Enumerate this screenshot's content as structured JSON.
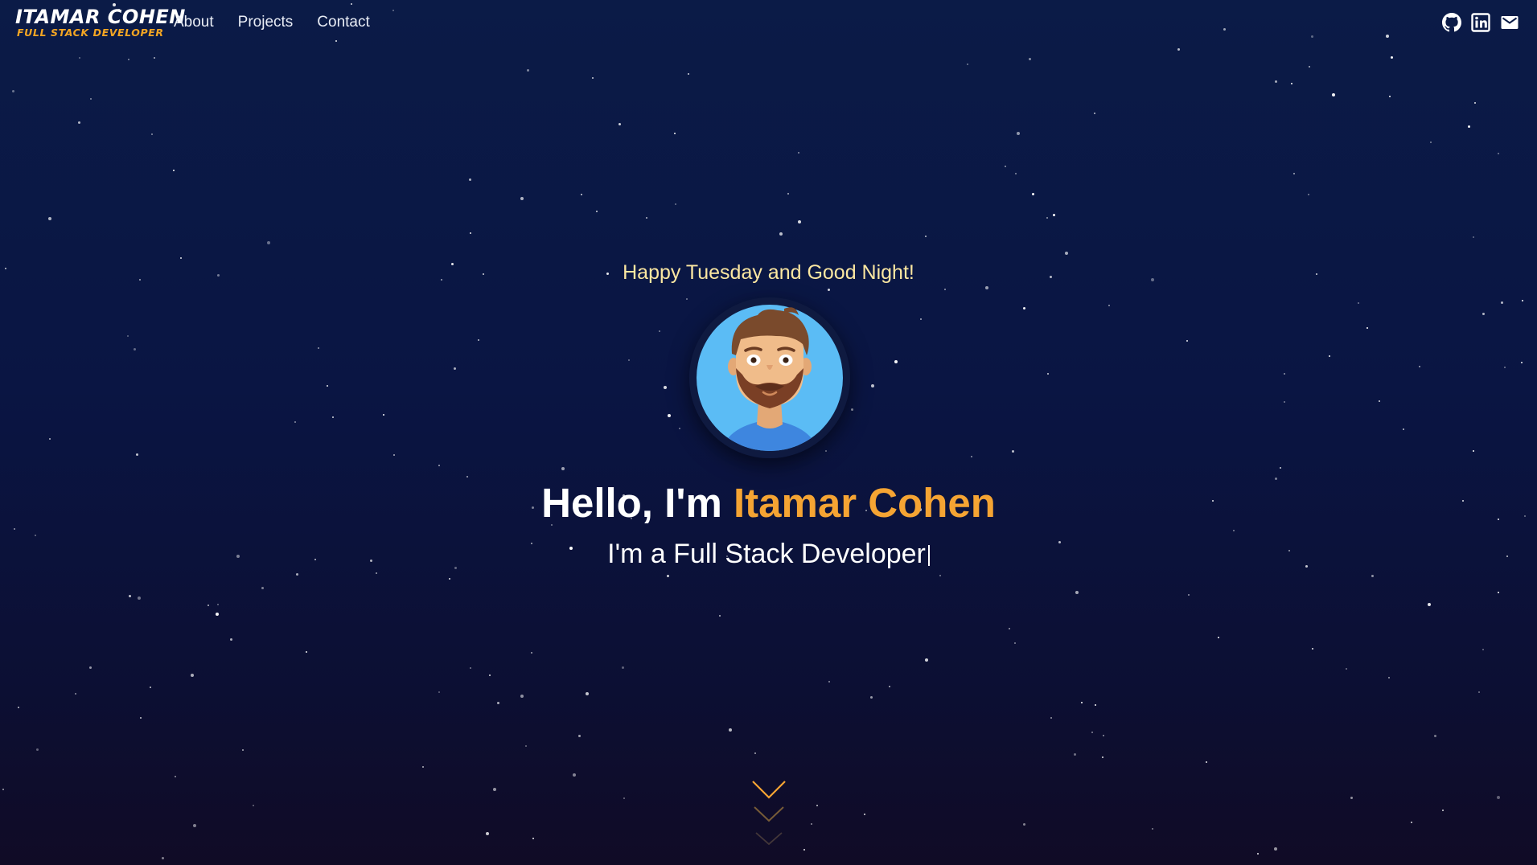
{
  "header": {
    "logo_name": "ITAMAR COHEN",
    "logo_role": "FULL STACK DEVELOPER",
    "nav": [
      {
        "label": "About"
      },
      {
        "label": "Projects"
      },
      {
        "label": "Contact"
      }
    ],
    "social": [
      {
        "icon": "github-icon"
      },
      {
        "icon": "linkedin-icon"
      },
      {
        "icon": "mail-icon"
      }
    ]
  },
  "hero": {
    "greeting": "Happy Tuesday and Good Night!",
    "hello_prefix": "Hello, I'm ",
    "name": "Itamar Cohen",
    "tagline": "I'm a Full Stack Developer",
    "avatar_icon": "developer-avatar",
    "scroll_icon": "chevron-down-icon"
  },
  "colors": {
    "accent": "#f5a433",
    "greeting": "#fbe7a1",
    "background_top": "#0b1b47",
    "background_bottom": "#100b26",
    "avatar_bg": "#5bbcf5"
  }
}
